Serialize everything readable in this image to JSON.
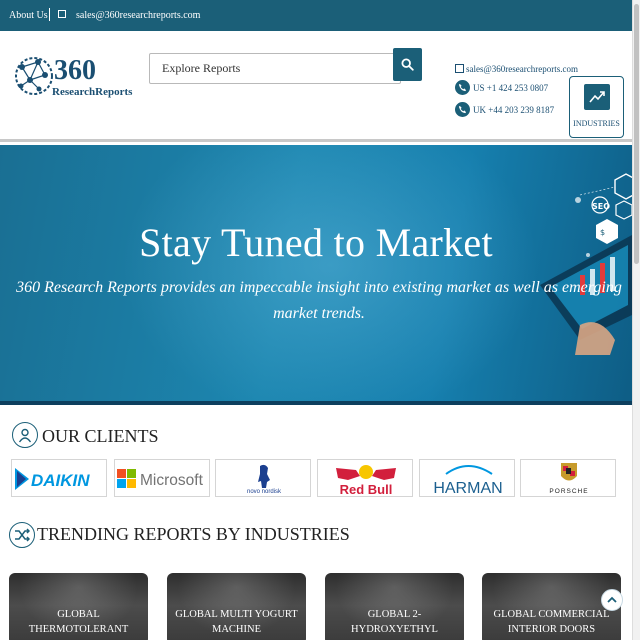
{
  "topbar": {
    "about_label": "About Us",
    "email": "sales@360researchreports.com"
  },
  "header": {
    "logo": {
      "number": "360",
      "name": "ResearchReports"
    },
    "search": {
      "placeholder": "Explore Reports"
    },
    "contact": {
      "email": "sales@360researchreports.com",
      "us_phone": "US +1 424 253 0807",
      "uk_phone": "UK +44 203 239 8187"
    },
    "industries_label": "INDUSTRIES"
  },
  "banner": {
    "title": "Stay Tuned to Market",
    "subtitle": "360 Research Reports provides an impeccable insight into existing market as well as emerging market trends."
  },
  "clients": {
    "title": "OUR CLIENTS",
    "logos": [
      {
        "name": "DAIKIN"
      },
      {
        "name": "Microsoft"
      },
      {
        "name": "novo nordisk"
      },
      {
        "name": "Red Bull"
      },
      {
        "name": "HARMAN"
      },
      {
        "name": "PORSCHE"
      }
    ]
  },
  "trending": {
    "title": "TRENDING REPORTS BY INDUSTRIES",
    "cards": [
      {
        "line1": "GLOBAL",
        "line2": "THERMOTOLERANT"
      },
      {
        "line1": "GLOBAL MULTI YOGURT",
        "line2": "MACHINE"
      },
      {
        "line1": "GLOBAL 2-",
        "line2": "HYDROXYETHYL"
      },
      {
        "line1": "GLOBAL COMMERCIAL",
        "line2": "INTERIOR DOORS"
      }
    ]
  },
  "colors": {
    "brand": "#1b5f78",
    "banner": "#1c86b0",
    "daikin": "#0097e0",
    "redbull": "#d21f3c"
  }
}
